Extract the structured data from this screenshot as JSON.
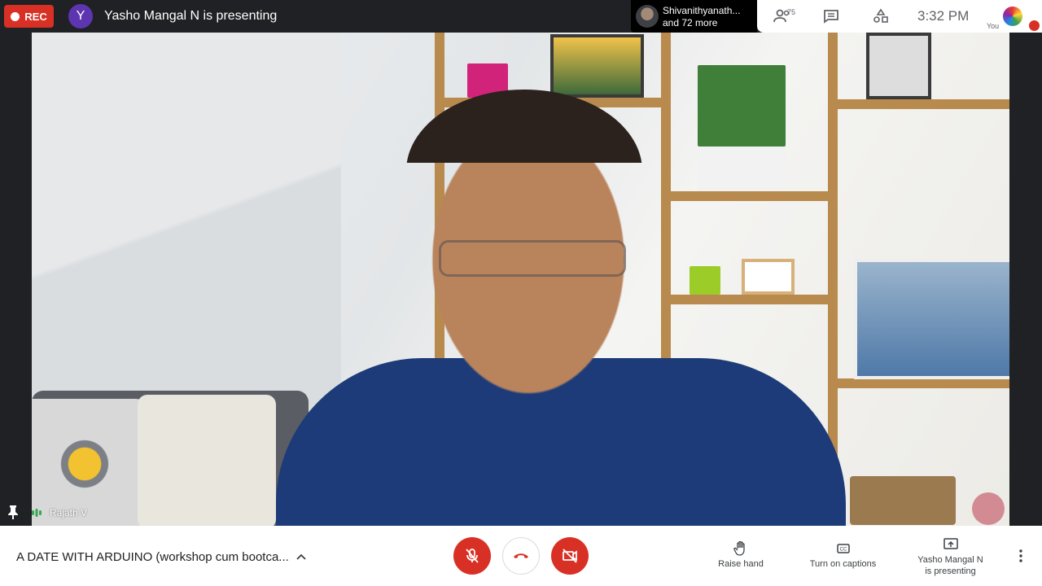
{
  "top_bar": {
    "rec_label": "REC",
    "presenter_initial": "Y",
    "presenting_text": "Yasho Mangal N is presenting"
  },
  "participants_chip": {
    "line1": "Shivanithyanath...",
    "line2": "and 72 more"
  },
  "right_panel": {
    "people_count": "75",
    "time": "3:32 PM",
    "you_label": "You"
  },
  "video": {
    "speaker_name": "Rajath V"
  },
  "bottom_bar": {
    "meeting_title": "A DATE WITH ARDUINO (workshop cum bootca...",
    "raise_hand_label": "Raise hand",
    "captions_label": "Turn on captions",
    "present_line1": "Yasho Mangal N",
    "present_line2": "is presenting"
  },
  "colors": {
    "recording_red": "#d93025",
    "presenter_avatar": "#5e35b1",
    "dark_background": "#202124"
  },
  "icons": [
    "record-dot-icon",
    "people-icon",
    "chat-icon",
    "activities-icon",
    "pin-icon",
    "speaking-icon",
    "chevron-up-icon",
    "mic-off-icon",
    "end-call-icon",
    "camera-off-icon",
    "raise-hand-icon",
    "captions-icon",
    "present-screen-icon",
    "more-vert-icon"
  ]
}
